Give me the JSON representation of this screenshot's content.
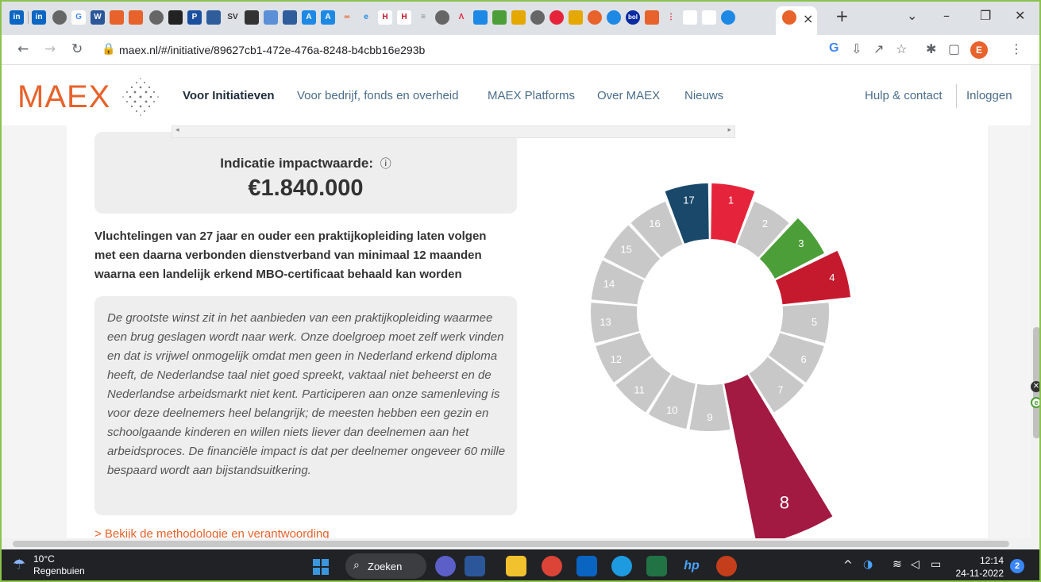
{
  "browser": {
    "url": "maex.nl/#/initiative/89627cb1-472e-476a-8248-b4cbb16e293b",
    "profile_initial": "E",
    "tab_close": "×",
    "new_tab": "+"
  },
  "site": {
    "logo": "MAEX",
    "nav": [
      "Voor Initiatieven",
      "Voor bedrijf, fonds en overheid",
      "MAEX Platforms",
      "Over MAEX",
      "Nieuws"
    ],
    "help": "Hulp & contact",
    "login": "Inloggen"
  },
  "impact": {
    "label": "Indicatie impactwaarde:",
    "value": "€1.840.000"
  },
  "goal": "Vluchtelingen van 27 jaar en ouder een praktijkopleiding laten volgen met een daarna verbonden dienstverband van minimaal 12 maanden waarna een landelijk erkend MBO-certificaat behaald kan worden",
  "description": "De grootste winst zit in het aanbieden van een praktijkopleiding waarmee een brug geslagen wordt naar werk. Onze doelgroep moet zelf werk vinden en dat is vrijwel onmogelijk omdat men geen in Nederland erkend diploma heeft, de Nederlandse taal niet goed spreekt, vaktaal niet beheerst en de Nederlandse arbeidsmarkt niet kent. Participeren aan onze samenleving is voor deze deelnemers heel belangrijk; de meesten hebben een gezin en schoolgaande kinderen en willen niets liever dan deelnemen aan het arbeidsproces. De financiële impact is dat per deelnemer ongeveer 60 mille bespaard wordt aan bijstandsuitkering.",
  "method_link": "> Bekijk de methodologie en verantwoording",
  "sdg": {
    "segments": [
      {
        "n": "1",
        "highlight": true,
        "color": "#e5243b",
        "level": 1
      },
      {
        "n": "2",
        "highlight": false,
        "color": "#c8c8c8",
        "level": 0
      },
      {
        "n": "3",
        "highlight": true,
        "color": "#4c9f38",
        "level": 1
      },
      {
        "n": "4",
        "highlight": true,
        "color": "#c5192d",
        "level": 2
      },
      {
        "n": "5",
        "highlight": false,
        "color": "#c8c8c8",
        "level": 0
      },
      {
        "n": "6",
        "highlight": false,
        "color": "#c8c8c8",
        "level": 0
      },
      {
        "n": "7",
        "highlight": false,
        "color": "#c8c8c8",
        "level": 0
      },
      {
        "n": "8",
        "highlight": true,
        "color": "#a21942",
        "level": 3
      },
      {
        "n": "9",
        "highlight": false,
        "color": "#c8c8c8",
        "level": 0
      },
      {
        "n": "10",
        "highlight": false,
        "color": "#c8c8c8",
        "level": 0
      },
      {
        "n": "11",
        "highlight": false,
        "color": "#c8c8c8",
        "level": 0
      },
      {
        "n": "12",
        "highlight": false,
        "color": "#c8c8c8",
        "level": 0
      },
      {
        "n": "13",
        "highlight": false,
        "color": "#c8c8c8",
        "level": 0
      },
      {
        "n": "14",
        "highlight": false,
        "color": "#c8c8c8",
        "level": 0
      },
      {
        "n": "15",
        "highlight": false,
        "color": "#c8c8c8",
        "level": 0
      },
      {
        "n": "16",
        "highlight": false,
        "color": "#c8c8c8",
        "level": 0
      },
      {
        "n": "17",
        "highlight": true,
        "color": "#19486a",
        "level": 1
      }
    ]
  },
  "taskbar": {
    "temp": "10°C",
    "weather": "Regenbuien",
    "search": "Zoeken",
    "time": "12:14",
    "date": "24-11-2022",
    "notifications": "2"
  }
}
